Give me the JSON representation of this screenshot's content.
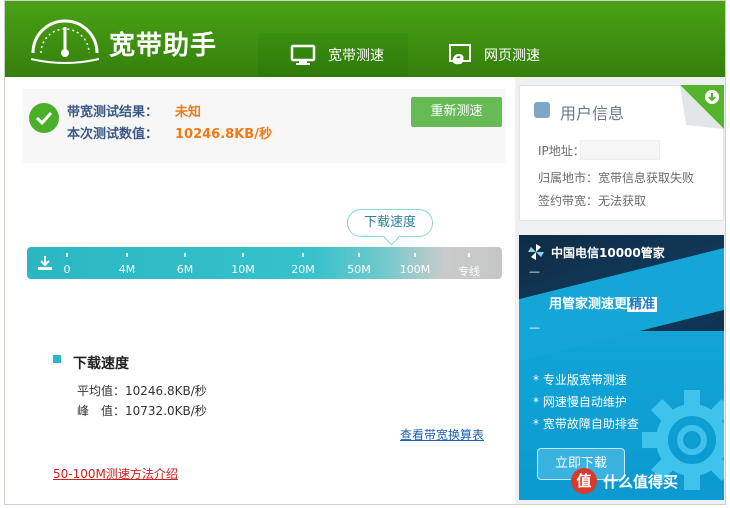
{
  "app": {
    "title": "宽带助手"
  },
  "tabs": [
    {
      "label": "宽带测速",
      "active": true
    },
    {
      "label": "网页测速",
      "active": false
    }
  ],
  "result": {
    "result_label": "带宽测试结果：",
    "result_value": "未知",
    "speed_label": "本次测试数值：",
    "speed_value": "10246.8KB/秒",
    "retest_label": "重新测速"
  },
  "gauge": {
    "bubble_label": "下载速度",
    "ticks": [
      "0",
      "4M",
      "6M",
      "10M",
      "20M",
      "50M",
      "100M",
      "专线"
    ]
  },
  "download": {
    "title": "下载速度",
    "avg_label": "平均值：",
    "avg_value": "10246.8KB/秒",
    "peak_label": "峰　值：",
    "peak_value": "10732.0KB/秒",
    "view_table_link": "查看带宽换算表",
    "method_link": "50-100M测速方法介绍"
  },
  "user_info": {
    "title": "用户信息",
    "ip_label": "IP地址：",
    "region_label": "归属地市：",
    "region_value": "宽带信息获取失败",
    "plan_label": "签约带宽：",
    "plan_value": "无法获取"
  },
  "ad": {
    "brand": "中国电信10000管家",
    "dash": "—",
    "headline": "用管家测速更",
    "headline_accent": "精准",
    "features": [
      "* 专业版宽带测速",
      "* 网速慢自动维护",
      "* 宽带故障自助排查"
    ],
    "button_label": "立即下载"
  },
  "watermark": {
    "mark": "值",
    "text": "什么值得买"
  },
  "colors": {
    "header_green": "#3e8f10",
    "accent_teal": "#2ab7c3",
    "result_orange": "#f07a14",
    "button_green": "#66bb56",
    "ad_blue": "#0fa1d4"
  }
}
